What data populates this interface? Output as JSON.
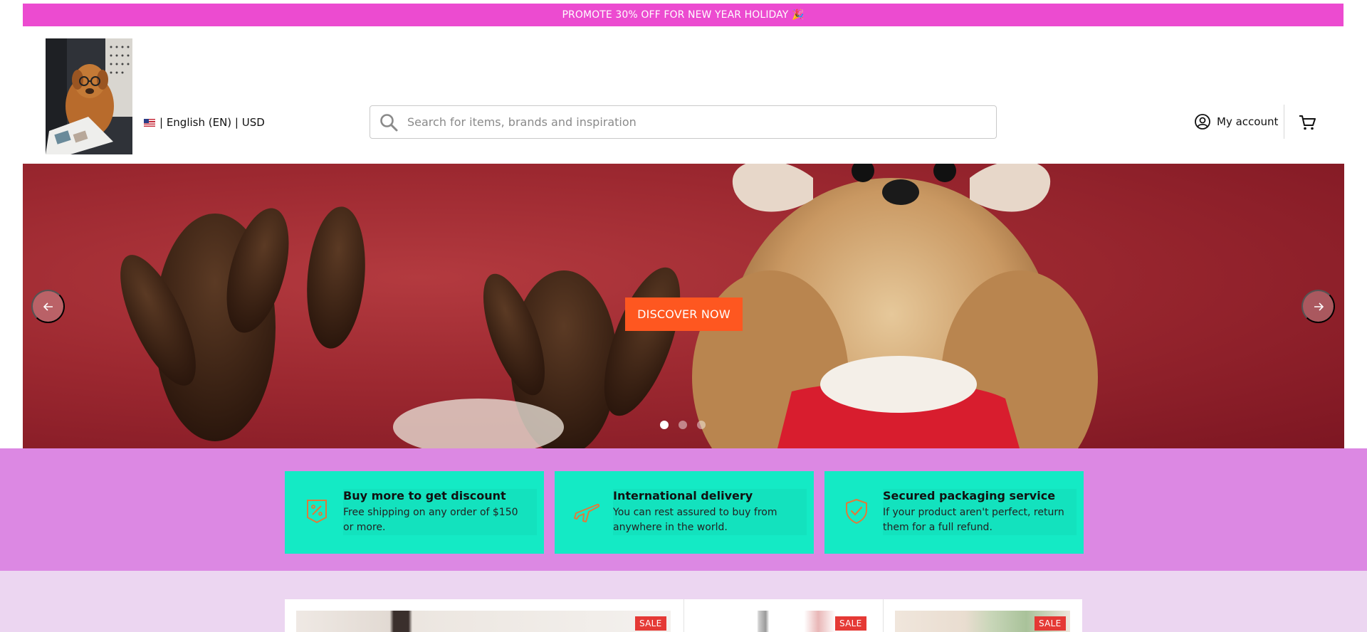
{
  "promo": {
    "text": "PROMOTE 30% OFF FOR NEW YEAR HOLIDAY 🎉"
  },
  "header": {
    "locale_text": "| English (EN) | USD",
    "search_placeholder": "Search for items, brands and inspiration",
    "account_label": "My account"
  },
  "hero": {
    "cta_label": "DISCOVER NOW",
    "slide_count": 3,
    "active_slide": 1
  },
  "features": [
    {
      "title": "Buy more to get discount",
      "desc": "Free shipping on any order of $150 or more.",
      "icon": "discount-tag-icon"
    },
    {
      "title": "International delivery",
      "desc": "You can rest assured to buy from anywhere in the world.",
      "icon": "airplane-icon"
    },
    {
      "title": "Secured packaging service",
      "desc": "If your product aren't perfect, return them for a full refund.",
      "icon": "shield-check-icon"
    }
  ],
  "products": {
    "badges": [
      "SALE",
      "SALE",
      "SALE"
    ]
  },
  "colors": {
    "promo_bg": "#ec4bd0",
    "cta_bg": "#fe5720",
    "features_bg": "#dc88e3",
    "feature_card_bg": "#14eac5",
    "feature_icon": "#e07a3a",
    "products_bg": "#ecd6f1",
    "sale_badge": "#e53935"
  }
}
